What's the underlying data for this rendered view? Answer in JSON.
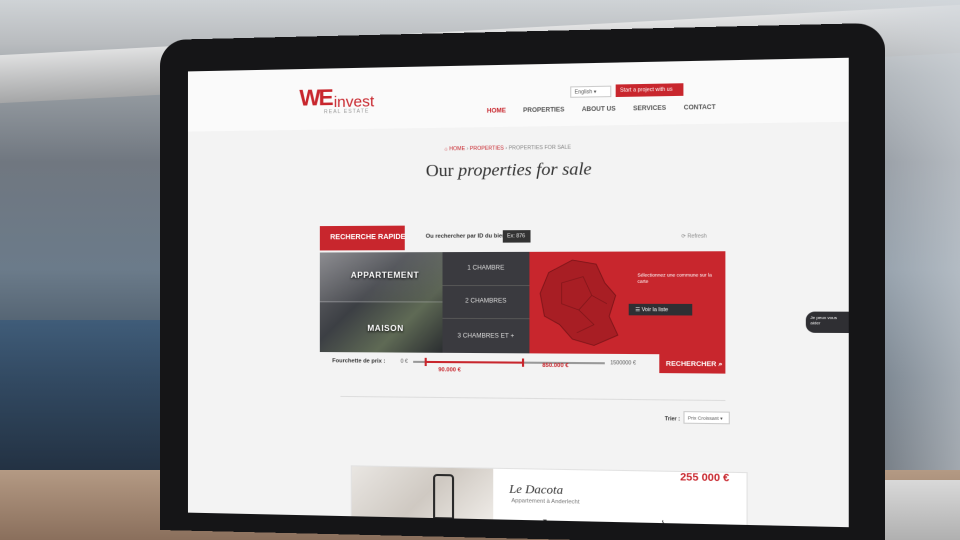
{
  "site": {
    "logo_mark": "WE",
    "logo_word": "invest",
    "logo_sub": "REAL ESTATE",
    "language": "English",
    "cta": "Start a project with us",
    "nav": [
      "HOME",
      "PROPERTIES",
      "ABOUT US",
      "SERVICES",
      "CONTACT"
    ],
    "active_nav": "HOME"
  },
  "breadcrumb": {
    "home": "HOME",
    "properties": "PROPERTIES",
    "current": "PROPERTIES FOR SALE"
  },
  "title": {
    "lead": "Our",
    "emph": "properties for sale"
  },
  "search": {
    "quick_tab": "RECHERCHE RAPIDE",
    "id_label": "Ou rechercher par ID du bien:",
    "id_placeholder": "Ex: 876",
    "refresh": "Refresh",
    "types": [
      "APPARTEMENT",
      "MAISON"
    ],
    "rooms": [
      "1 CHAMBRE",
      "2 CHAMBRES",
      "3 CHAMBRES ET +"
    ],
    "map_legend": "Sélectionnez une commune sur la carte",
    "list_button": "Voir la liste",
    "search_button": "RECHERCHER"
  },
  "price_range": {
    "label": "Fourchette de prix :",
    "min": "0 €",
    "low": "90.000 €",
    "high": "850.000 €",
    "max": "1500000 €",
    "low_fraction": 0.06,
    "high_fraction": 0.57
  },
  "sort": {
    "label": "Trier :",
    "value": "Prix Croissant"
  },
  "listing": {
    "title": "Le Dacota",
    "subtitle": "Appartement à Anderlecht",
    "price": "255 000 €"
  },
  "chat": "Je peux vous aider",
  "colors": {
    "brand_red": "#c8262d",
    "dark_panel": "#2f2f33"
  }
}
